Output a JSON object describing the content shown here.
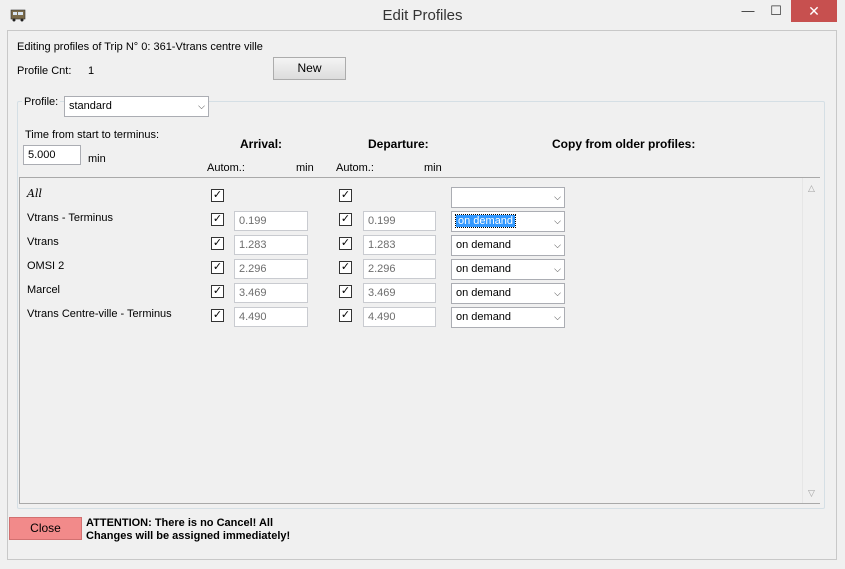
{
  "window": {
    "title": "Edit Profiles",
    "minimize_glyph": "—",
    "maximize_glyph": "☐",
    "close_glyph": "✕",
    "app_icon": "bus-icon"
  },
  "header": {
    "editing_text": "Editing profiles of Trip N° 0: 361-Vtrans centre ville",
    "profile_cnt_label": "Profile Cnt:",
    "profile_cnt_value": "1",
    "new_button": "New"
  },
  "profile": {
    "label": "Profile:",
    "selected": "standard"
  },
  "time": {
    "label": "Time from start to terminus:",
    "value": "5.000",
    "unit": "min"
  },
  "columns": {
    "arrival": "Arrival:",
    "departure": "Departure:",
    "copy": "Copy from older profiles:",
    "arr_autom": "Autom.:",
    "arr_min": "min",
    "dep_autom": "Autom.:",
    "dep_min": "min"
  },
  "rows": [
    {
      "name": "All",
      "arr_checked": true,
      "arr_value": "",
      "dep_checked": true,
      "dep_value": "",
      "copy": ""
    },
    {
      "name": "Vtrans - Terminus",
      "arr_checked": true,
      "arr_value": "0.199",
      "dep_checked": true,
      "dep_value": "0.199",
      "copy": "on demand"
    },
    {
      "name": "Vtrans",
      "arr_checked": true,
      "arr_value": "1.283",
      "dep_checked": true,
      "dep_value": "1.283",
      "copy": "on demand"
    },
    {
      "name": "OMSI 2",
      "arr_checked": true,
      "arr_value": "2.296",
      "dep_checked": true,
      "dep_value": "2.296",
      "copy": "on demand"
    },
    {
      "name": "Marcel",
      "arr_checked": true,
      "arr_value": "3.469",
      "dep_checked": true,
      "dep_value": "3.469",
      "copy": "on demand"
    },
    {
      "name": "Vtrans Centre-ville - Terminus",
      "arr_checked": true,
      "arr_value": "4.490",
      "dep_checked": true,
      "dep_value": "4.490",
      "copy": "on demand"
    }
  ],
  "footer": {
    "close_button": "Close",
    "attention_line1": "ATTENTION: There is no Cancel! All",
    "attention_line2": "Changes will be assigned immediately!"
  },
  "colors": {
    "close_button_bg": "#f28a8a",
    "titlebar_close_bg": "#c7504f",
    "selection_bg": "#3399ff"
  }
}
